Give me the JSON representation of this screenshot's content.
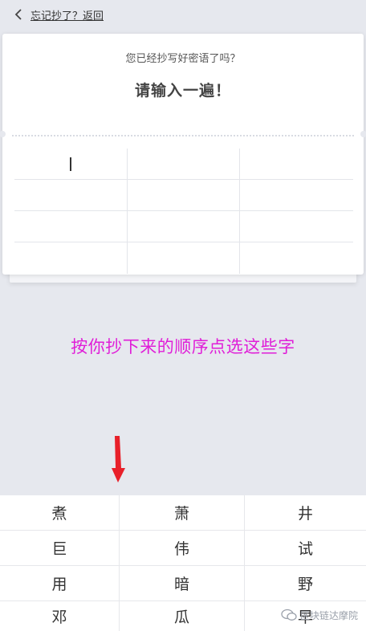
{
  "header": {
    "back_label": "忘记抄了？返回",
    "back_icon": "chevron-left-icon"
  },
  "card": {
    "question": "您已经抄写好密语了吗？",
    "heading": "请输入一遍！",
    "grid_cells": [
      "",
      "",
      "",
      "",
      "",
      "",
      "",
      "",
      "",
      "",
      "",
      ""
    ]
  },
  "annotation": {
    "text": "按你抄下来的顺序点选这些字",
    "color": "#e01ed8"
  },
  "keypad": {
    "keys": [
      "煮",
      "萧",
      "井",
      "巨",
      "伟",
      "试",
      "用",
      "暗",
      "野",
      "邓",
      "瓜",
      "早"
    ]
  },
  "watermark": {
    "text": "区块链达摩院"
  },
  "colors": {
    "background": "#e6e8ee",
    "arrow": "#e8202a"
  }
}
